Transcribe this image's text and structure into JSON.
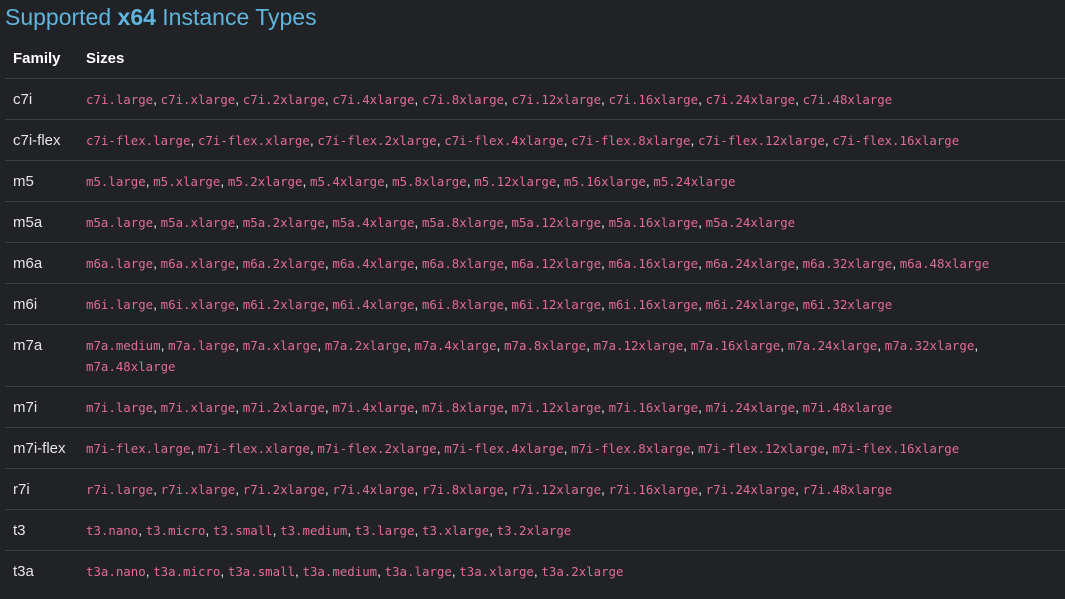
{
  "heading": {
    "prefix": "Supported ",
    "arch": "x64",
    "suffix": " Instance Types"
  },
  "table": {
    "headers": {
      "family": "Family",
      "sizes": "Sizes"
    },
    "separator": ",",
    "rows": [
      {
        "family": "c7i",
        "sizes": [
          "c7i.large",
          "c7i.xlarge",
          "c7i.2xlarge",
          "c7i.4xlarge",
          "c7i.8xlarge",
          "c7i.12xlarge",
          "c7i.16xlarge",
          "c7i.24xlarge",
          "c7i.48xlarge"
        ]
      },
      {
        "family": "c7i-flex",
        "sizes": [
          "c7i-flex.large",
          "c7i-flex.xlarge",
          "c7i-flex.2xlarge",
          "c7i-flex.4xlarge",
          "c7i-flex.8xlarge",
          "c7i-flex.12xlarge",
          "c7i-flex.16xlarge"
        ]
      },
      {
        "family": "m5",
        "sizes": [
          "m5.large",
          "m5.xlarge",
          "m5.2xlarge",
          "m5.4xlarge",
          "m5.8xlarge",
          "m5.12xlarge",
          "m5.16xlarge",
          "m5.24xlarge"
        ]
      },
      {
        "family": "m5a",
        "sizes": [
          "m5a.large",
          "m5a.xlarge",
          "m5a.2xlarge",
          "m5a.4xlarge",
          "m5a.8xlarge",
          "m5a.12xlarge",
          "m5a.16xlarge",
          "m5a.24xlarge"
        ]
      },
      {
        "family": "m6a",
        "sizes": [
          "m6a.large",
          "m6a.xlarge",
          "m6a.2xlarge",
          "m6a.4xlarge",
          "m6a.8xlarge",
          "m6a.12xlarge",
          "m6a.16xlarge",
          "m6a.24xlarge",
          "m6a.32xlarge",
          "m6a.48xlarge"
        ]
      },
      {
        "family": "m6i",
        "sizes": [
          "m6i.large",
          "m6i.xlarge",
          "m6i.2xlarge",
          "m6i.4xlarge",
          "m6i.8xlarge",
          "m6i.12xlarge",
          "m6i.16xlarge",
          "m6i.24xlarge",
          "m6i.32xlarge"
        ]
      },
      {
        "family": "m7a",
        "sizes": [
          "m7a.medium",
          "m7a.large",
          "m7a.xlarge",
          "m7a.2xlarge",
          "m7a.4xlarge",
          "m7a.8xlarge",
          "m7a.12xlarge",
          "m7a.16xlarge",
          "m7a.24xlarge",
          "m7a.32xlarge",
          "m7a.48xlarge"
        ]
      },
      {
        "family": "m7i",
        "sizes": [
          "m7i.large",
          "m7i.xlarge",
          "m7i.2xlarge",
          "m7i.4xlarge",
          "m7i.8xlarge",
          "m7i.12xlarge",
          "m7i.16xlarge",
          "m7i.24xlarge",
          "m7i.48xlarge"
        ]
      },
      {
        "family": "m7i-flex",
        "sizes": [
          "m7i-flex.large",
          "m7i-flex.xlarge",
          "m7i-flex.2xlarge",
          "m7i-flex.4xlarge",
          "m7i-flex.8xlarge",
          "m7i-flex.12xlarge",
          "m7i-flex.16xlarge"
        ]
      },
      {
        "family": "r7i",
        "sizes": [
          "r7i.large",
          "r7i.xlarge",
          "r7i.2xlarge",
          "r7i.4xlarge",
          "r7i.8xlarge",
          "r7i.12xlarge",
          "r7i.16xlarge",
          "r7i.24xlarge",
          "r7i.48xlarge"
        ]
      },
      {
        "family": "t3",
        "sizes": [
          "t3.nano",
          "t3.micro",
          "t3.small",
          "t3.medium",
          "t3.large",
          "t3.xlarge",
          "t3.2xlarge"
        ]
      },
      {
        "family": "t3a",
        "sizes": [
          "t3a.nano",
          "t3a.micro",
          "t3a.small",
          "t3a.medium",
          "t3a.large",
          "t3a.xlarge",
          "t3a.2xlarge"
        ]
      }
    ]
  },
  "colors": {
    "background": "#202226",
    "heading": "#5fb5de",
    "code": "#e26b97",
    "text": "#e6e6e6",
    "row_border": "#3c3f44"
  }
}
